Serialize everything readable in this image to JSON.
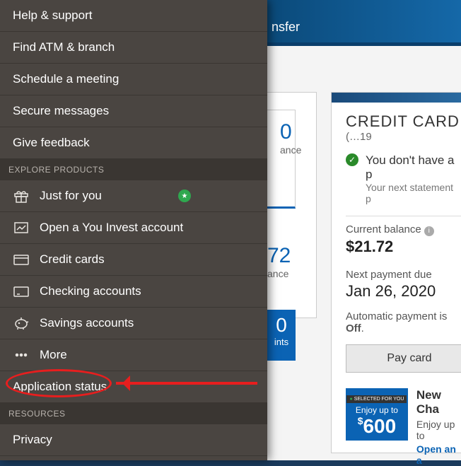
{
  "topbar": {
    "transfer_label": "nsfer"
  },
  "menu": {
    "help": "Help & support",
    "atm": "Find ATM & branch",
    "schedule": "Schedule a meeting",
    "secure": "Secure messages",
    "feedback": "Give feedback",
    "section_explore": "EXPLORE PRODUCTS",
    "just_for_you": "Just for you",
    "you_invest": "Open a You Invest account",
    "credit_cards": "Credit cards",
    "checking": "Checking accounts",
    "savings": "Savings accounts",
    "more": "More",
    "app_status": "Application status",
    "section_resources": "RESOURCES",
    "privacy": "Privacy"
  },
  "left_card": {
    "amt1_suffix": "0",
    "amt1_label": "ance",
    "amt2": "72",
    "amt2_label": "ance",
    "stat_num": "0",
    "stat_label": "ints"
  },
  "cc": {
    "title": "CREDIT CARD",
    "acct": "(…19",
    "no_payment": "You don't have a p",
    "next_stmt": "Your next statement p",
    "cur_bal_label": "Current balance",
    "cur_bal_val": "$21.72",
    "next_pay_label": "Next payment due",
    "next_pay_val": "Jan 26, 2020",
    "auto_pay_pre": "Automatic payment is ",
    "auto_pay_state": "Off",
    "auto_pay_post": ".",
    "pay_btn": "Pay card"
  },
  "promo": {
    "selected": "SELECTED FOR YOU",
    "enjoy": "Enjoy up to",
    "amount": "600",
    "title": "New Cha",
    "sub": "Enjoy up to",
    "link": "Open an a"
  }
}
